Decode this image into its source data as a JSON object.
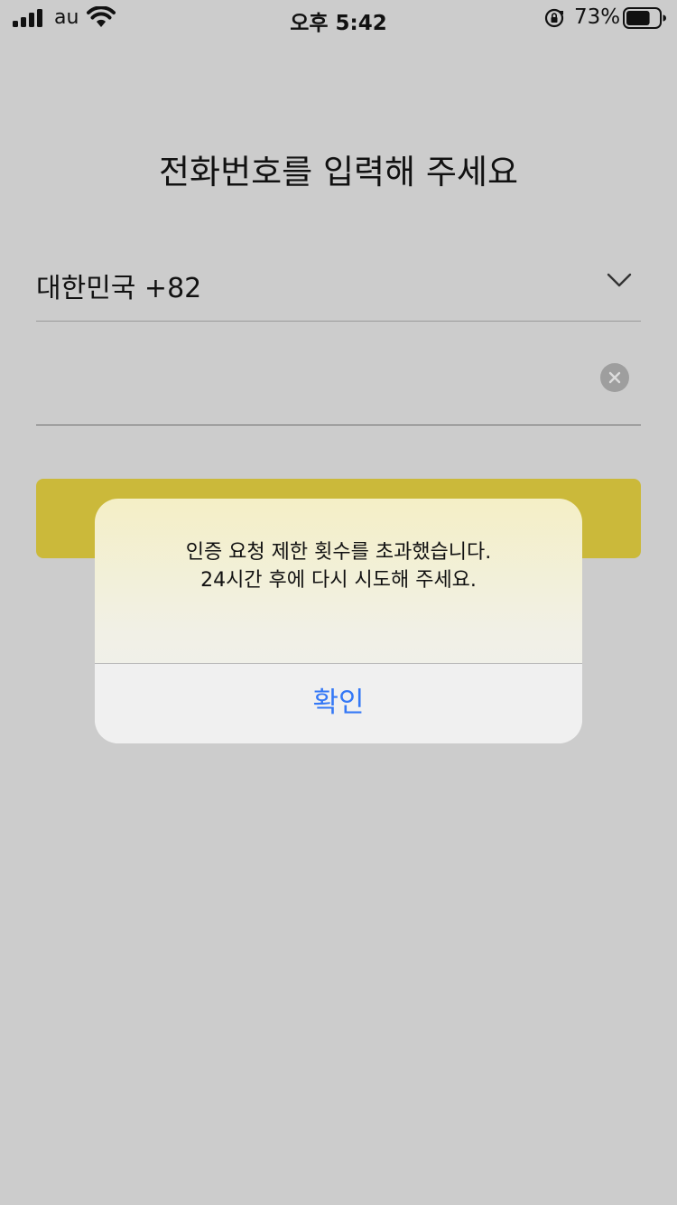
{
  "status_bar": {
    "carrier": "au",
    "time": "오후 5:42",
    "battery_percent": "73%",
    "battery_level": 0.73,
    "icons": [
      "signal-icon",
      "wifi-icon",
      "rotation-lock-icon",
      "battery-icon"
    ]
  },
  "page": {
    "title": "전화번호를 입력해 주세요"
  },
  "country_select": {
    "value": "대한민국 +82"
  },
  "phone_input": {
    "value": "",
    "placeholder": ""
  },
  "colors": {
    "background": "#cccccc",
    "submit_button": "#cbb93a",
    "alert_action": "#3478f6"
  },
  "alert": {
    "message_line1": "인증 요청 제한 횟수를 초과했습니다.",
    "message_line2": "24시간 후에 다시 시도해 주세요.",
    "confirm_label": "확인"
  }
}
